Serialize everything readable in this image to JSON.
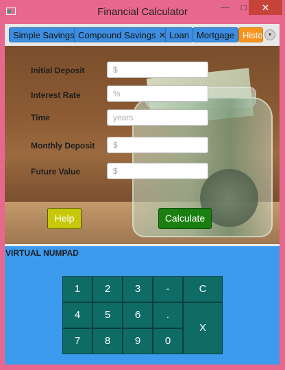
{
  "window": {
    "title": "Financial Calculator",
    "minimize": "—",
    "maximize": "□",
    "close": "✕"
  },
  "tabs": [
    {
      "label": "Simple Savings"
    },
    {
      "label": "Compound Savings",
      "close": "✕"
    },
    {
      "label": "Loan"
    },
    {
      "label": "Mortgage"
    },
    {
      "label": "Histo"
    }
  ],
  "tab_menu": "▾",
  "form": {
    "fields": [
      {
        "label": "Initial Deposit",
        "placeholder": "$",
        "value": ""
      },
      {
        "label": "Interest Rate",
        "placeholder": "%",
        "value": ""
      },
      {
        "label": "Time",
        "placeholder": "years",
        "value": ""
      },
      {
        "label": "Monthly Deposit",
        "placeholder": "$",
        "value": ""
      },
      {
        "label": "Future Value",
        "placeholder": "$",
        "value": ""
      }
    ],
    "help_label": "Help",
    "calculate_label": "Calculate"
  },
  "numpad": {
    "title": "VIRTUAL NUMPAD",
    "keys": [
      "1",
      "2",
      "3",
      "-",
      "C",
      "4",
      "5",
      "6",
      ".",
      "X",
      "7",
      "8",
      "9",
      "0"
    ]
  },
  "colors": {
    "titlebar": "#e8678f",
    "tab": "#3d8ee0",
    "tab_active_history": "#f7941d",
    "help_button": "#c8c80a",
    "calculate_button": "#1a7f10",
    "numpad_bg": "#3d9bee",
    "key": "#0f6b66"
  }
}
